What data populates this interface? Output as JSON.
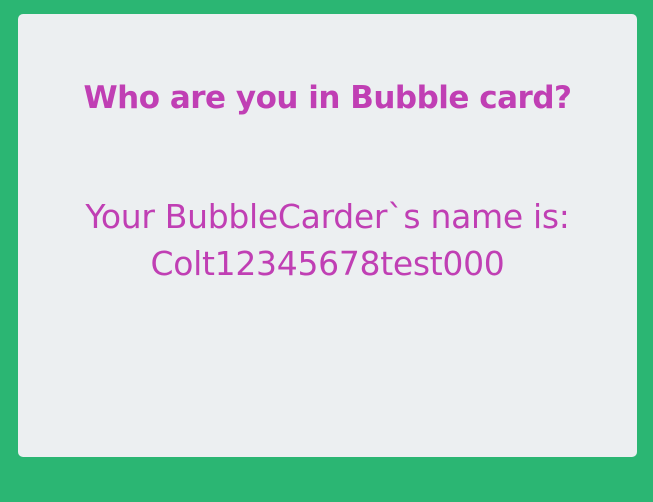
{
  "card": {
    "title": "Who are you in Bubble card?",
    "result_label": "Your BubbleCarder`s name is:",
    "result_name": "Colt12345678test000"
  },
  "colors": {
    "page_background": "#2bb673",
    "card_background": "#eceff1",
    "text_accent": "#c03fb4"
  }
}
